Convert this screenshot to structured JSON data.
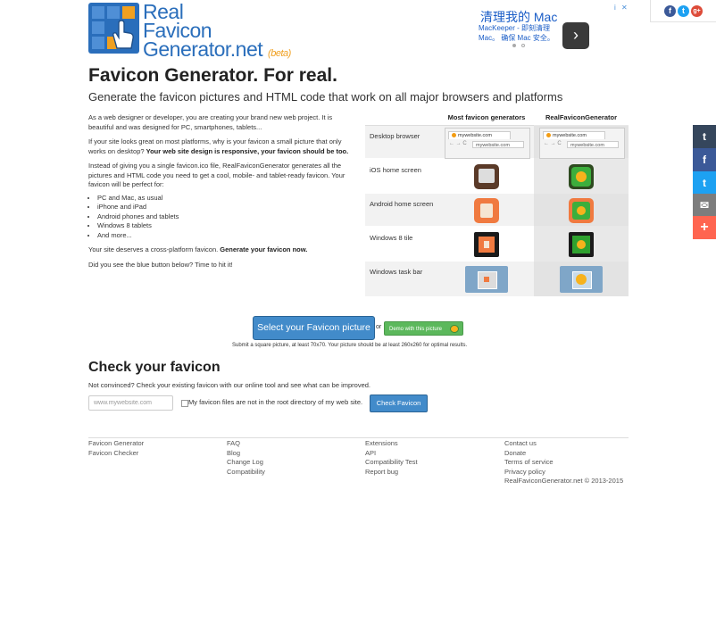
{
  "header": {
    "logo_line1": "Real",
    "logo_line2": "Favicon",
    "logo_line3": "Generator.net",
    "beta": "(beta)"
  },
  "ad": {
    "title": "清理我的 Mac",
    "line1": "MacKeeper - 即刻清理",
    "line2": "Mac。 确保 Mac 安全。",
    "arrow": "›",
    "choices": "i",
    "close": "✕"
  },
  "social_top": [
    {
      "name": "facebook-icon",
      "glyph": "f",
      "color": "#3b5998"
    },
    {
      "name": "twitter-icon",
      "glyph": "t",
      "color": "#1da1f2"
    },
    {
      "name": "google-plus-icon",
      "glyph": "g+",
      "color": "#dd4b39"
    }
  ],
  "social_side": [
    {
      "name": "tumblr-icon",
      "glyph": "t",
      "color": "#35465c"
    },
    {
      "name": "facebook-share-icon",
      "glyph": "f",
      "color": "#3b5998"
    },
    {
      "name": "twitter-share-icon",
      "glyph": "t",
      "color": "#1da1f2"
    },
    {
      "name": "email-share-icon",
      "glyph": "✉",
      "color": "#7d7d7d"
    },
    {
      "name": "more-share-icon",
      "glyph": "+",
      "color": "#ff6550"
    }
  ],
  "main": {
    "title": "Favicon Generator. For real.",
    "subtitle": "Generate the favicon pictures and HTML code that work on all major browsers and platforms",
    "p1": "As a web designer or developer, you are creating your brand new web project. It is beautiful and was designed for PC, smartphones, tablets...",
    "p2_normal": "If your site looks great on most platforms, why is your favicon a small picture that only works on desktop? ",
    "p2_bold": "Your web site design is responsive, your favicon should be too.",
    "p3": "Instead of giving you a single favicon.ico file, RealFaviconGenerator generates all the pictures and HTML code you need to get a cool, mobile- and tablet-ready favicon. Your favicon will be perfect for:",
    "list": [
      "PC and Mac, as usual",
      "iPhone and iPad",
      "Android phones and tablets",
      "Windows 8 tablets",
      "And more..."
    ],
    "p4_normal": "Your site deserves a cross-platform favicon. ",
    "p4_bold": "Generate your favicon now.",
    "p5": "Did you see the blue button below? Time to hit it!"
  },
  "comparison": {
    "col1": "Most favicon generators",
    "col2": "RealFaviconGenerator",
    "rows": [
      "Desktop browser",
      "iOS home screen",
      "Android home screen",
      "Windows 8 tile",
      "Windows task bar"
    ],
    "tab_text": "mywebsite.com",
    "url_text": "mywebsite.com"
  },
  "actions": {
    "select_button": "Select your Favicon picture",
    "or": "or",
    "demo_button": "Demo with this picture",
    "note": "Submit a square picture, at least 70x70. Your picture should be at least 260x260 for optimal results."
  },
  "checker": {
    "title": "Check your favicon",
    "description": "Not convinced? Check your existing favicon with our online tool and see what can be improved.",
    "input_placeholder": "www.mywebsite.com",
    "checkbox_label": "My favicon files are not in the root directory of my web site.",
    "button": "Check Favicon"
  },
  "footer": {
    "col1": [
      "Favicon Generator",
      "Favicon Checker"
    ],
    "col2": [
      "FAQ",
      "Blog",
      "Change Log",
      "Compatibility"
    ],
    "col3": [
      "Extensions",
      "API",
      "Compatibility Test",
      "Report bug"
    ],
    "col4": [
      "Contact us",
      "Donate",
      "Terms of service",
      "Privacy policy",
      "RealFaviconGenerator.net © 2013-2015"
    ]
  }
}
